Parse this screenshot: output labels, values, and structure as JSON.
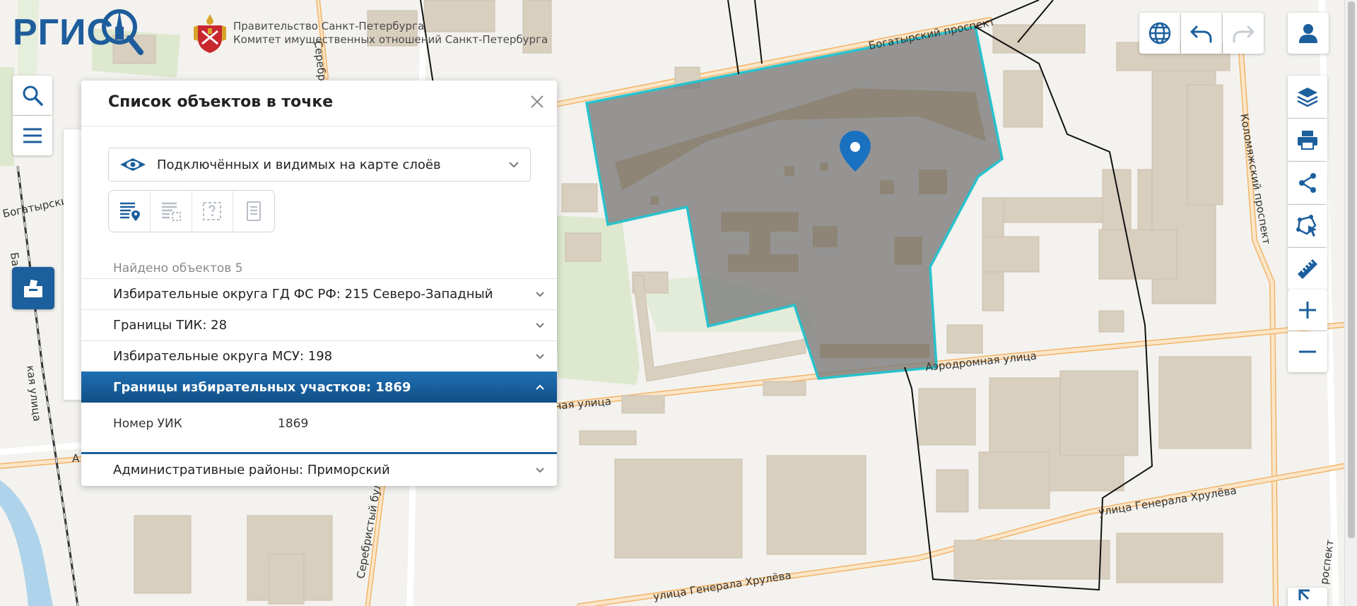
{
  "header": {
    "logo_text": "РГИС",
    "gov_line1": "Правительство Санкт-Петербурга",
    "gov_line2": "Комитет имущественных отношений Санкт-Петербурга"
  },
  "panel": {
    "title": "Список объектов в точке",
    "layer_select": "Подключённых и видимых на карте слоёв",
    "found_label": "Найдено объектов 5",
    "rows": [
      {
        "label": "Избирательные округа ГД ФС РФ: 215 Северо-Западный"
      },
      {
        "label": "Границы ТИК: 28"
      },
      {
        "label": "Избирательные округа МСУ: 198"
      },
      {
        "label": "Границы избирательных участков: 1869"
      },
      {
        "label": "Административные районы: Приморский"
      }
    ],
    "detail": {
      "key": "Номер УИК",
      "value": "1869"
    }
  },
  "map": {
    "streets": {
      "bogatyrsky_top": "Богатырский проспект",
      "bogatyrsky_left": "Богатырский",
      "serebristy_top": "Серебри",
      "serebristy_bottom": "Серебристый бул",
      "aerodromnaya": "Аэродромная улица",
      "naya_ulitsa": "ная улица",
      "kolomyazhsky": "Коломяжский проспект",
      "prospekt_br": "роспект",
      "khruleva_right": "улица Генерала Хрулёва",
      "khruleva_bottom": "улица Генерала Хрулёва",
      "kaya_ulitsa": "кая улица",
      "ba_vertical": "Ба",
      "a_left": "А"
    },
    "colors": {
      "background": "#f3f2ee",
      "building": "#d9cfbf",
      "highlight_fill": "#7a7a7a",
      "highlight_stroke": "#28c2cc",
      "park": "#dde8cf",
      "major_road": "#f2b46a",
      "brand": "#1d5d9c",
      "panel_active": "#1c5f9d"
    }
  },
  "icons": {
    "globe": "globe-icon",
    "undo": "undo-icon",
    "redo": "redo-icon",
    "user": "user-icon",
    "search": "search-icon",
    "menu": "menu-icon",
    "ballot": "ballot-box-icon",
    "layers": "layers-icon",
    "print": "print-icon",
    "share": "share-icon",
    "draw": "draw-polygon-icon",
    "measure": "ruler-icon",
    "zoom_in": "plus-icon",
    "zoom_out": "minus-icon",
    "fullscreen": "fullscreen-icon",
    "pin": "map-pin-icon"
  }
}
